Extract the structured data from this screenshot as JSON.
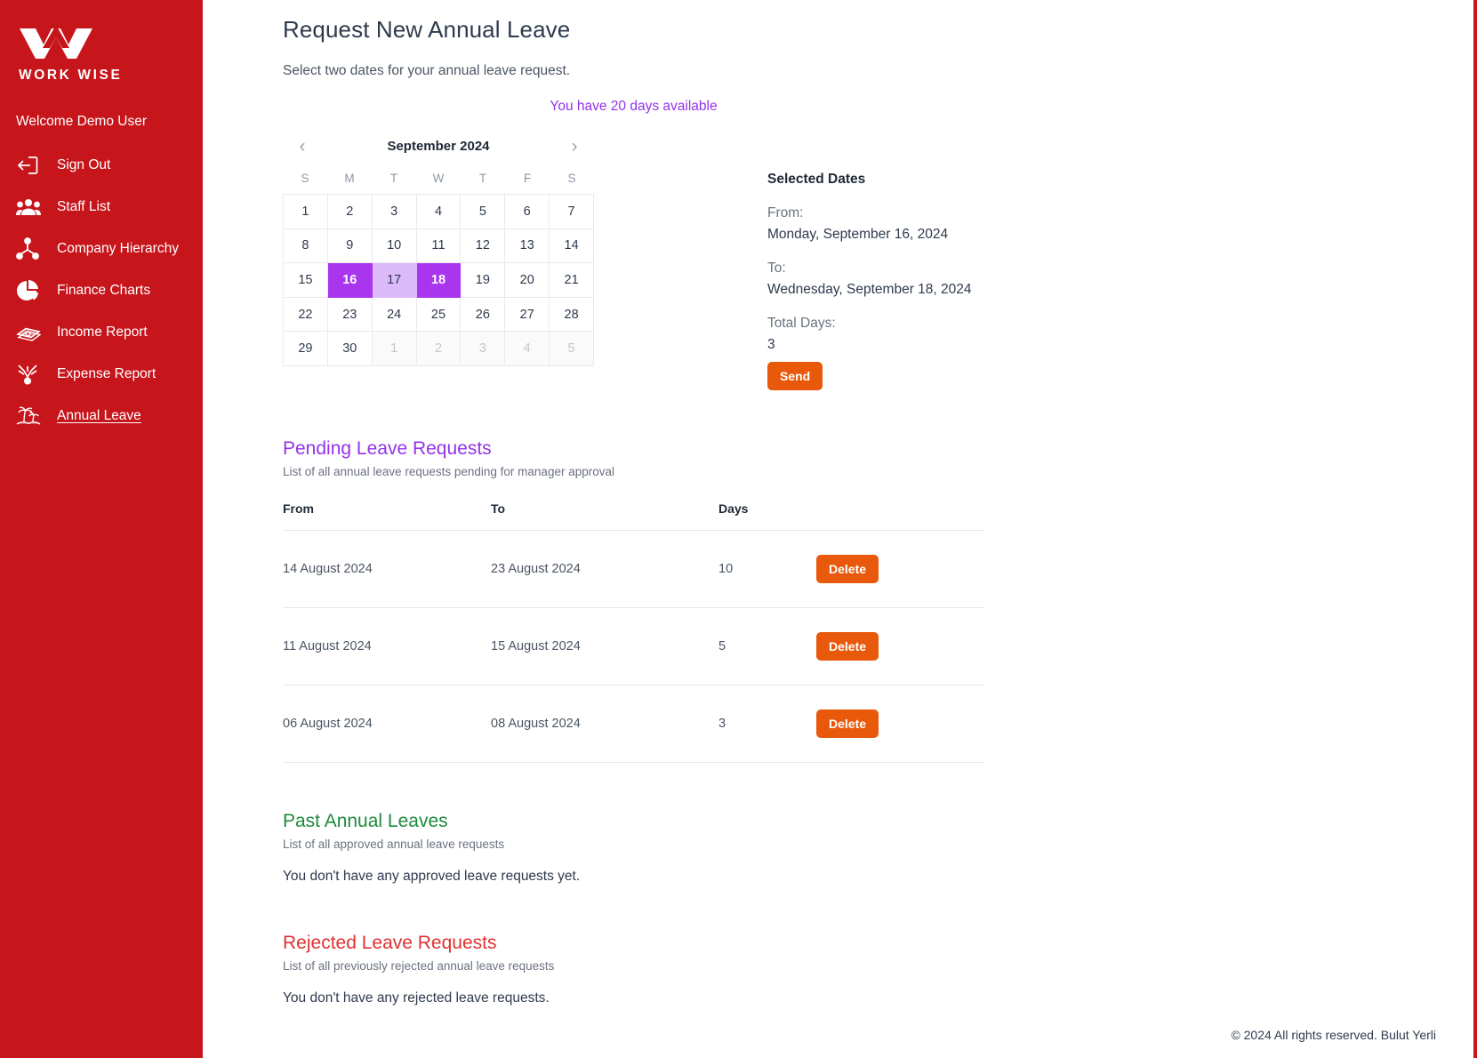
{
  "sidebar": {
    "logo_text": "WORK WISE",
    "welcome": "Welcome Demo User",
    "items": [
      {
        "label": "Sign Out",
        "icon": "sign-out-icon"
      },
      {
        "label": "Staff List",
        "icon": "people-icon"
      },
      {
        "label": "Company Hierarchy",
        "icon": "hierarchy-icon"
      },
      {
        "label": "Finance Charts",
        "icon": "pie-chart-icon"
      },
      {
        "label": "Income Report",
        "icon": "money-stack-icon"
      },
      {
        "label": "Expense Report",
        "icon": "expense-icon"
      },
      {
        "label": "Annual Leave",
        "icon": "palm-island-icon"
      }
    ]
  },
  "main": {
    "title": "Request New Annual Leave",
    "subtitle": "Select two dates for your annual leave request.",
    "availability": "You have 20 days available"
  },
  "calendar": {
    "month_label": "September 2024",
    "prev_label": "‹",
    "next_label": "›",
    "dow": [
      "S",
      "M",
      "T",
      "W",
      "T",
      "F",
      "S"
    ],
    "weeks": [
      [
        {
          "d": "1",
          "state": "normal"
        },
        {
          "d": "2",
          "state": "normal"
        },
        {
          "d": "3",
          "state": "normal"
        },
        {
          "d": "4",
          "state": "normal"
        },
        {
          "d": "5",
          "state": "normal"
        },
        {
          "d": "6",
          "state": "normal"
        },
        {
          "d": "7",
          "state": "normal"
        }
      ],
      [
        {
          "d": "8",
          "state": "normal"
        },
        {
          "d": "9",
          "state": "normal"
        },
        {
          "d": "10",
          "state": "normal"
        },
        {
          "d": "11",
          "state": "normal"
        },
        {
          "d": "12",
          "state": "normal"
        },
        {
          "d": "13",
          "state": "normal"
        },
        {
          "d": "14",
          "state": "normal"
        }
      ],
      [
        {
          "d": "15",
          "state": "normal"
        },
        {
          "d": "16",
          "state": "sel-end"
        },
        {
          "d": "17",
          "state": "sel-mid"
        },
        {
          "d": "18",
          "state": "sel-end"
        },
        {
          "d": "19",
          "state": "normal"
        },
        {
          "d": "20",
          "state": "normal"
        },
        {
          "d": "21",
          "state": "normal"
        }
      ],
      [
        {
          "d": "22",
          "state": "normal"
        },
        {
          "d": "23",
          "state": "normal"
        },
        {
          "d": "24",
          "state": "normal"
        },
        {
          "d": "25",
          "state": "normal"
        },
        {
          "d": "26",
          "state": "normal"
        },
        {
          "d": "27",
          "state": "normal"
        },
        {
          "d": "28",
          "state": "normal"
        }
      ],
      [
        {
          "d": "29",
          "state": "normal"
        },
        {
          "d": "30",
          "state": "normal"
        },
        {
          "d": "1",
          "state": "muted"
        },
        {
          "d": "2",
          "state": "muted"
        },
        {
          "d": "3",
          "state": "muted"
        },
        {
          "d": "4",
          "state": "muted"
        },
        {
          "d": "5",
          "state": "muted"
        }
      ]
    ]
  },
  "selected": {
    "heading": "Selected Dates",
    "from_label": "From:",
    "from_value": "Monday, September 16, 2024",
    "to_label": "To:",
    "to_value": "Wednesday, September 18, 2024",
    "total_label": "Total Days:",
    "total_value": "3",
    "send_label": "Send"
  },
  "pending": {
    "title": "Pending Leave Requests",
    "subtitle": "List of all annual leave requests pending for manager approval",
    "columns": [
      "From",
      "To",
      "Days",
      ""
    ],
    "rows": [
      {
        "from": "14 August 2024",
        "to": "23 August 2024",
        "days": "10",
        "action": "Delete"
      },
      {
        "from": "11 August 2024",
        "to": "15 August 2024",
        "days": "5",
        "action": "Delete"
      },
      {
        "from": "06 August 2024",
        "to": "08 August 2024",
        "days": "3",
        "action": "Delete"
      }
    ]
  },
  "past": {
    "title": "Past Annual Leaves",
    "subtitle": "List of all approved annual leave requests",
    "empty": "You don't have any approved leave requests yet."
  },
  "rejected": {
    "title": "Rejected Leave Requests",
    "subtitle": "List of all previously rejected annual leave requests",
    "empty": "You don't have any rejected leave requests."
  },
  "footer": {
    "text": "© 2024 All rights reserved. Bulut Yerli"
  },
  "colors": {
    "brand_red": "#c7151c",
    "accent_purple": "#9333ea",
    "selection_purple": "#a935ee",
    "selection_light": "#dcb9fa",
    "orange": "#e8590c",
    "green": "#1e8a3c",
    "red": "#e03131"
  }
}
